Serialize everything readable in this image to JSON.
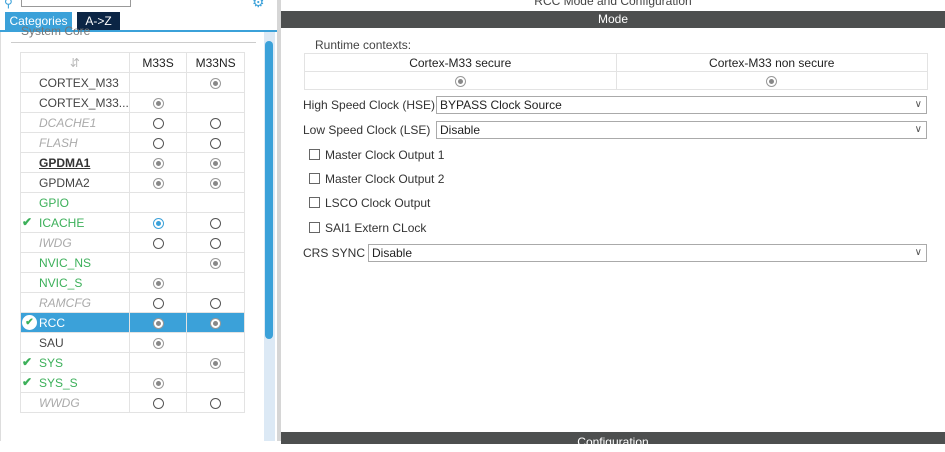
{
  "left": {
    "tabs": [
      "Categories",
      "A->Z"
    ],
    "group_title": "System Core",
    "table": {
      "columns": [
        "M33S",
        "M33NS"
      ],
      "rows": [
        {
          "name": "CORTEX_M33",
          "style": "normal",
          "check": "",
          "m33s": "",
          "m33ns": "g"
        },
        {
          "name": "CORTEX_M33...",
          "style": "normal",
          "check": "",
          "m33s": "g",
          "m33ns": ""
        },
        {
          "name": "DCACHE1",
          "style": "disabled",
          "check": "",
          "m33s": "o",
          "m33ns": "o"
        },
        {
          "name": "FLASH",
          "style": "disabled",
          "check": "",
          "m33s": "o",
          "m33ns": "o"
        },
        {
          "name": "GPDMA1",
          "style": "bold",
          "check": "",
          "m33s": "g",
          "m33ns": "g"
        },
        {
          "name": "GPDMA2",
          "style": "normal",
          "check": "",
          "m33s": "g",
          "m33ns": "g"
        },
        {
          "name": "GPIO",
          "style": "ok",
          "check": "",
          "m33s": "",
          "m33ns": ""
        },
        {
          "name": "ICACHE",
          "style": "ok",
          "check": "tick",
          "m33s": "b",
          "m33ns": "o"
        },
        {
          "name": "IWDG",
          "style": "disabled",
          "check": "",
          "m33s": "o",
          "m33ns": "o"
        },
        {
          "name": "NVIC_NS",
          "style": "ok",
          "check": "",
          "m33s": "",
          "m33ns": "g"
        },
        {
          "name": "NVIC_S",
          "style": "ok",
          "check": "",
          "m33s": "g",
          "m33ns": ""
        },
        {
          "name": "RAMCFG",
          "style": "disabled",
          "check": "",
          "m33s": "o",
          "m33ns": "o"
        },
        {
          "name": "RCC",
          "style": "normal",
          "check": "circle",
          "selected": true,
          "m33s": "g",
          "m33ns": "g"
        },
        {
          "name": "SAU",
          "style": "normal",
          "check": "",
          "m33s": "g",
          "m33ns": ""
        },
        {
          "name": "SYS",
          "style": "ok",
          "check": "tick",
          "m33s": "",
          "m33ns": "g"
        },
        {
          "name": "SYS_S",
          "style": "ok",
          "check": "tick",
          "m33s": "g",
          "m33ns": ""
        },
        {
          "name": "WWDG",
          "style": "disabled",
          "check": "",
          "m33s": "o",
          "m33ns": "o"
        }
      ]
    }
  },
  "right": {
    "title": "RCC Mode and Configuration",
    "mode_bar": "Mode",
    "runtime_label": "Runtime contexts:",
    "contexts": [
      "Cortex-M33 secure",
      "Cortex-M33 non secure"
    ],
    "hse": {
      "label": "High Speed Clock (HSE)",
      "value": "BYPASS Clock Source"
    },
    "lse": {
      "label": "Low Speed Clock (LSE)",
      "value": "Disable"
    },
    "checkboxes": [
      "Master Clock Output 1",
      "Master Clock Output 2",
      "LSCO Clock Output",
      "SAI1 Extern CLock"
    ],
    "crs": {
      "label": "CRS SYNC",
      "value": "Disable"
    },
    "config_bar": "Configuration"
  }
}
